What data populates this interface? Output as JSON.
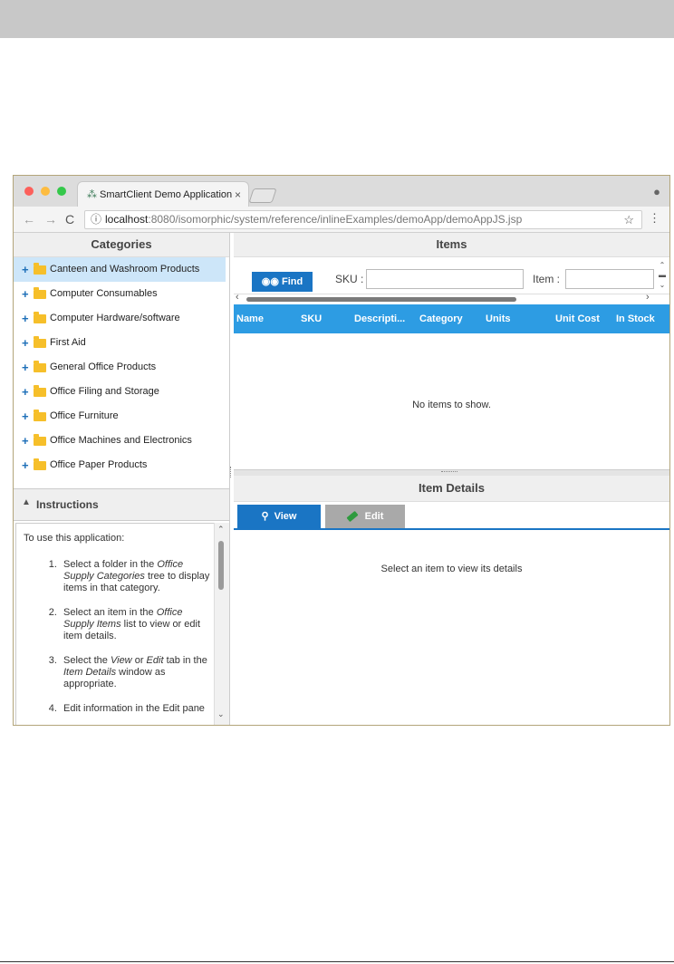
{
  "browser": {
    "tab_title": "SmartClient Demo Application",
    "tab_close": "×",
    "url_host": "localhost",
    "url_rest": ":8080/isomorphic/system/reference/inlineExamples/demoApp/demoAppJS.jsp"
  },
  "categories": {
    "title": "Categories",
    "items": [
      {
        "label": "Canteen and Washroom Products",
        "selected": true
      },
      {
        "label": "Computer Consumables"
      },
      {
        "label": "Computer Hardware/software"
      },
      {
        "label": "First Aid"
      },
      {
        "label": "General Office Products"
      },
      {
        "label": "Office Filing and Storage"
      },
      {
        "label": "Office Furniture"
      },
      {
        "label": "Office Machines and Electronics"
      },
      {
        "label": "Office Paper Products"
      }
    ]
  },
  "instructions": {
    "title": "Instructions",
    "intro": "To use this application:",
    "steps": [
      {
        "a": "Select a folder in the ",
        "em": "Office Supply Categories",
        "b": " tree to display items in that category."
      },
      {
        "a": "Select an item in the ",
        "em": "Office Supply Items",
        "b": " list to view or edit item details."
      },
      {
        "a": "Select the ",
        "em": "View",
        "b": " or ",
        "em2": "Edit",
        "c": " tab in the ",
        "em3": "Item Details",
        "d": " window as appropriate."
      },
      {
        "a": "Edit information in the Edit pane"
      }
    ]
  },
  "items": {
    "title": "Items",
    "find_label": "Find",
    "sku_label": "SKU :",
    "sku_value": "",
    "item_label": "Item :",
    "item_value": "",
    "columns": [
      "Name",
      "SKU",
      "Descripti...",
      "Category",
      "Units",
      "Unit Cost",
      "In Stock"
    ],
    "empty_message": "No items to show."
  },
  "details": {
    "title": "Item Details",
    "tab_view": "View",
    "tab_edit": "Edit",
    "empty_message": "Select an item to view its details"
  },
  "colors": {
    "accent": "#1a75c4",
    "grid_header": "#2d9ce3",
    "selected_row": "#cde6f9"
  }
}
